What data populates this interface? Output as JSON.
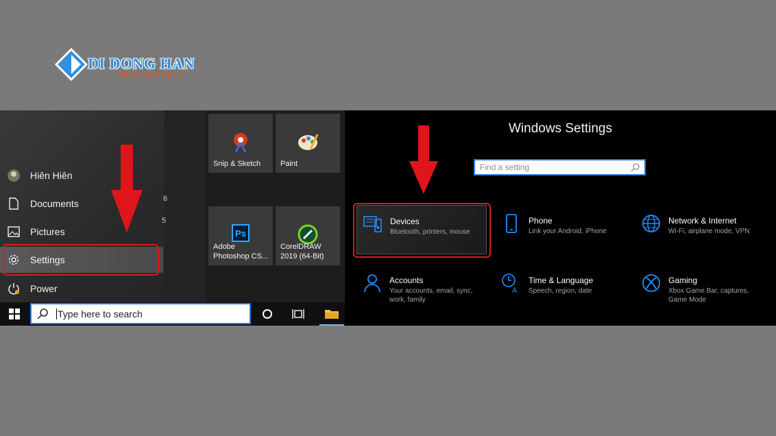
{
  "logo": {
    "brand": "DI DONG HAN",
    "tagline": "Trải nghiệm & Gắn bó"
  },
  "start_menu": {
    "items": [
      {
        "label": "Hiên Hiên",
        "icon": "user-avatar"
      },
      {
        "label": "Documents",
        "icon": "document-icon"
      },
      {
        "label": "Pictures",
        "icon": "pictures-icon"
      },
      {
        "label": "Settings",
        "icon": "gear-icon"
      },
      {
        "label": "Power",
        "icon": "power-icon"
      }
    ],
    "stray_chars": [
      "6",
      "5"
    ],
    "tiles": [
      {
        "label": "Snip & Sketch",
        "icon": "snip-sketch-icon"
      },
      {
        "label": "Paint",
        "icon": "paint-icon"
      },
      {
        "label": "Adobe\nPhotoshop CS...",
        "icon": "photoshop-icon",
        "icon_text": "Ps"
      },
      {
        "label": "CorelDRAW\n2019 (64-Bit)",
        "icon": "coreldraw-icon"
      }
    ]
  },
  "taskbar": {
    "search_placeholder": "Type here to search"
  },
  "settings": {
    "title": "Windows Settings",
    "search_placeholder": "Find a setting",
    "categories": [
      {
        "title": "Devices",
        "desc": "Bluetooth, printers, mouse",
        "icon": "devices-icon"
      },
      {
        "title": "Phone",
        "desc": "Link your Android, iPhone",
        "icon": "phone-icon"
      },
      {
        "title": "Network & Internet",
        "desc": "Wi-Fi, airplane mode, VPN",
        "icon": "globe-icon"
      },
      {
        "title": "Accounts",
        "desc": "Your accounts, email, sync, work, family",
        "icon": "person-icon"
      },
      {
        "title": "Time & Language",
        "desc": "Speech, region, date",
        "icon": "time-language-icon"
      },
      {
        "title": "Gaming",
        "desc": "Xbox Game Bar, captures, Game Mode",
        "icon": "xbox-icon"
      }
    ]
  },
  "colors": {
    "accent": "#2d7cd8",
    "highlight": "#d91c1c",
    "settings_icon": "#1e90ff"
  }
}
